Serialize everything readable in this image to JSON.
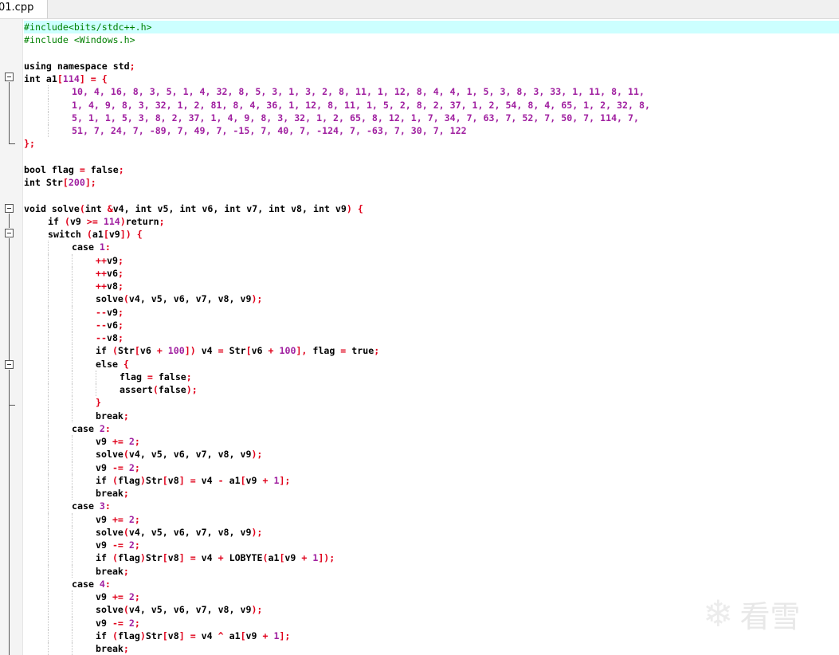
{
  "editor": {
    "tab_label": "01.cpp",
    "watermark_text": "看雪",
    "lines": [
      {
        "indent": 0,
        "hl": true,
        "tokens": [
          [
            "pp",
            "#include<bits/stdc++.h>"
          ]
        ]
      },
      {
        "indent": 0,
        "tokens": [
          [
            "pp",
            "#include <Windows.h>"
          ]
        ]
      },
      {
        "indent": 0,
        "tokens": []
      },
      {
        "indent": 0,
        "tokens": [
          [
            "kw",
            "using namespace "
          ],
          [
            "plain",
            "std"
          ],
          [
            "op",
            ";"
          ]
        ]
      },
      {
        "indent": 0,
        "tokens": [
          [
            "kw",
            "int "
          ],
          [
            "plain",
            "a1"
          ],
          [
            "op",
            "["
          ],
          [
            "num",
            "114"
          ],
          [
            "op",
            "] = {"
          ]
        ]
      },
      {
        "indent": 2,
        "tokens": [
          [
            "num",
            "10, 4, 16, 8, 3, 5, 1, 4, 32, 8, 5, 3, 1, 3, 2, 8, 11, 1, 12, 8, 4, 4, 1, 5, 3, 8, 3, 33, 1, 11, 8, 11,"
          ]
        ]
      },
      {
        "indent": 2,
        "tokens": [
          [
            "num",
            "1, 4, 9, 8, 3, 32, 1, 2, 81, 8, 4, 36, 1, 12, 8, 11, 1, 5, 2, 8, 2, 37, 1, 2, 54, 8, 4, 65, 1, 2, 32, 8,"
          ]
        ]
      },
      {
        "indent": 2,
        "tokens": [
          [
            "num",
            "5, 1, 1, 5, 3, 8, 2, 37, 1, 4, 9, 8, 3, 32, 1, 2, 65, 8, 12, 1, 7, 34, 7, 63, 7, 52, 7, 50, 7, 114, 7,"
          ]
        ]
      },
      {
        "indent": 2,
        "tokens": [
          [
            "num",
            "51, 7, 24, 7, -89, 7, 49, 7, -15, 7, 40, 7, -124, 7, -63, 7, 30, 7, 122"
          ]
        ]
      },
      {
        "indent": 0,
        "tokens": [
          [
            "op",
            "};"
          ]
        ]
      },
      {
        "indent": 0,
        "tokens": []
      },
      {
        "indent": 0,
        "tokens": [
          [
            "kw",
            "bool "
          ],
          [
            "plain",
            "flag "
          ],
          [
            "op",
            "= "
          ],
          [
            "kw",
            "false"
          ],
          [
            "op",
            ";"
          ]
        ]
      },
      {
        "indent": 0,
        "tokens": [
          [
            "kw",
            "int "
          ],
          [
            "plain",
            "Str"
          ],
          [
            "op",
            "["
          ],
          [
            "num",
            "200"
          ],
          [
            "op",
            "];"
          ]
        ]
      },
      {
        "indent": 0,
        "tokens": []
      },
      {
        "indent": 0,
        "tokens": [
          [
            "kw",
            "void "
          ],
          [
            "plain",
            "solve"
          ],
          [
            "op",
            "("
          ],
          [
            "kw",
            "int "
          ],
          [
            "op",
            "&"
          ],
          [
            "plain",
            "v4, "
          ],
          [
            "kw",
            "int "
          ],
          [
            "plain",
            "v5, "
          ],
          [
            "kw",
            "int "
          ],
          [
            "plain",
            "v6, "
          ],
          [
            "kw",
            "int "
          ],
          [
            "plain",
            "v7, "
          ],
          [
            "kw",
            "int "
          ],
          [
            "plain",
            "v8, "
          ],
          [
            "kw",
            "int "
          ],
          [
            "plain",
            "v9"
          ],
          [
            "op",
            ") {"
          ]
        ]
      },
      {
        "indent": 1,
        "tokens": [
          [
            "kw",
            "if "
          ],
          [
            "op",
            "("
          ],
          [
            "plain",
            "v9 "
          ],
          [
            "op",
            ">= "
          ],
          [
            "num",
            "114"
          ],
          [
            "op",
            ")"
          ],
          [
            "kw",
            "return"
          ],
          [
            "op",
            ";"
          ]
        ]
      },
      {
        "indent": 1,
        "tokens": [
          [
            "kw",
            "switch "
          ],
          [
            "op",
            "("
          ],
          [
            "plain",
            "a1"
          ],
          [
            "op",
            "["
          ],
          [
            "plain",
            "v9"
          ],
          [
            "op",
            "]) {"
          ]
        ]
      },
      {
        "indent": 2,
        "tokens": [
          [
            "kw",
            "case "
          ],
          [
            "num",
            "1"
          ],
          [
            "op",
            ":"
          ]
        ]
      },
      {
        "indent": 3,
        "tokens": [
          [
            "op",
            "++"
          ],
          [
            "plain",
            "v9"
          ],
          [
            "op",
            ";"
          ]
        ]
      },
      {
        "indent": 3,
        "tokens": [
          [
            "op",
            "++"
          ],
          [
            "plain",
            "v6"
          ],
          [
            "op",
            ";"
          ]
        ]
      },
      {
        "indent": 3,
        "tokens": [
          [
            "op",
            "++"
          ],
          [
            "plain",
            "v8"
          ],
          [
            "op",
            ";"
          ]
        ]
      },
      {
        "indent": 3,
        "tokens": [
          [
            "plain",
            "solve"
          ],
          [
            "op",
            "("
          ],
          [
            "plain",
            "v4, v5, v6, v7, v8, v9"
          ],
          [
            "op",
            ");"
          ]
        ]
      },
      {
        "indent": 3,
        "tokens": [
          [
            "op",
            "--"
          ],
          [
            "plain",
            "v9"
          ],
          [
            "op",
            ";"
          ]
        ]
      },
      {
        "indent": 3,
        "tokens": [
          [
            "op",
            "--"
          ],
          [
            "plain",
            "v6"
          ],
          [
            "op",
            ";"
          ]
        ]
      },
      {
        "indent": 3,
        "tokens": [
          [
            "op",
            "--"
          ],
          [
            "plain",
            "v8"
          ],
          [
            "op",
            ";"
          ]
        ]
      },
      {
        "indent": 3,
        "tokens": [
          [
            "kw",
            "if "
          ],
          [
            "op",
            "("
          ],
          [
            "plain",
            "Str"
          ],
          [
            "op",
            "["
          ],
          [
            "plain",
            "v6 "
          ],
          [
            "op",
            "+ "
          ],
          [
            "num",
            "100"
          ],
          [
            "op",
            "]) "
          ],
          [
            "plain",
            "v4 "
          ],
          [
            "op",
            "= "
          ],
          [
            "plain",
            "Str"
          ],
          [
            "op",
            "["
          ],
          [
            "plain",
            "v6 "
          ],
          [
            "op",
            "+ "
          ],
          [
            "num",
            "100"
          ],
          [
            "op",
            "], "
          ],
          [
            "plain",
            "flag "
          ],
          [
            "op",
            "= "
          ],
          [
            "kw",
            "true"
          ],
          [
            "op",
            ";"
          ]
        ]
      },
      {
        "indent": 3,
        "tokens": [
          [
            "kw",
            "else "
          ],
          [
            "op",
            "{"
          ]
        ]
      },
      {
        "indent": 4,
        "tokens": [
          [
            "plain",
            "flag "
          ],
          [
            "op",
            "= "
          ],
          [
            "kw",
            "false"
          ],
          [
            "op",
            ";"
          ]
        ]
      },
      {
        "indent": 4,
        "tokens": [
          [
            "plain",
            "assert"
          ],
          [
            "op",
            "("
          ],
          [
            "kw",
            "false"
          ],
          [
            "op",
            ");"
          ]
        ]
      },
      {
        "indent": 3,
        "tokens": [
          [
            "op",
            "}"
          ]
        ]
      },
      {
        "indent": 3,
        "tokens": [
          [
            "kw",
            "break"
          ],
          [
            "op",
            ";"
          ]
        ]
      },
      {
        "indent": 2,
        "tokens": [
          [
            "kw",
            "case "
          ],
          [
            "num",
            "2"
          ],
          [
            "op",
            ":"
          ]
        ]
      },
      {
        "indent": 3,
        "tokens": [
          [
            "plain",
            "v9 "
          ],
          [
            "op",
            "+= "
          ],
          [
            "num",
            "2"
          ],
          [
            "op",
            ";"
          ]
        ]
      },
      {
        "indent": 3,
        "tokens": [
          [
            "plain",
            "solve"
          ],
          [
            "op",
            "("
          ],
          [
            "plain",
            "v4, v5, v6, v7, v8, v9"
          ],
          [
            "op",
            ");"
          ]
        ]
      },
      {
        "indent": 3,
        "tokens": [
          [
            "plain",
            "v9 "
          ],
          [
            "op",
            "-= "
          ],
          [
            "num",
            "2"
          ],
          [
            "op",
            ";"
          ]
        ]
      },
      {
        "indent": 3,
        "tokens": [
          [
            "kw",
            "if "
          ],
          [
            "op",
            "("
          ],
          [
            "plain",
            "flag"
          ],
          [
            "op",
            ")"
          ],
          [
            "plain",
            "Str"
          ],
          [
            "op",
            "["
          ],
          [
            "plain",
            "v8"
          ],
          [
            "op",
            "] = "
          ],
          [
            "plain",
            "v4 "
          ],
          [
            "op",
            "- "
          ],
          [
            "plain",
            "a1"
          ],
          [
            "op",
            "["
          ],
          [
            "plain",
            "v9 "
          ],
          [
            "op",
            "+ "
          ],
          [
            "num",
            "1"
          ],
          [
            "op",
            "];"
          ]
        ]
      },
      {
        "indent": 3,
        "tokens": [
          [
            "kw",
            "break"
          ],
          [
            "op",
            ";"
          ]
        ]
      },
      {
        "indent": 2,
        "tokens": [
          [
            "kw",
            "case "
          ],
          [
            "num",
            "3"
          ],
          [
            "op",
            ":"
          ]
        ]
      },
      {
        "indent": 3,
        "tokens": [
          [
            "plain",
            "v9 "
          ],
          [
            "op",
            "+= "
          ],
          [
            "num",
            "2"
          ],
          [
            "op",
            ";"
          ]
        ]
      },
      {
        "indent": 3,
        "tokens": [
          [
            "plain",
            "solve"
          ],
          [
            "op",
            "("
          ],
          [
            "plain",
            "v4, v5, v6, v7, v8, v9"
          ],
          [
            "op",
            ");"
          ]
        ]
      },
      {
        "indent": 3,
        "tokens": [
          [
            "plain",
            "v9 "
          ],
          [
            "op",
            "-= "
          ],
          [
            "num",
            "2"
          ],
          [
            "op",
            ";"
          ]
        ]
      },
      {
        "indent": 3,
        "tokens": [
          [
            "kw",
            "if "
          ],
          [
            "op",
            "("
          ],
          [
            "plain",
            "flag"
          ],
          [
            "op",
            ")"
          ],
          [
            "plain",
            "Str"
          ],
          [
            "op",
            "["
          ],
          [
            "plain",
            "v8"
          ],
          [
            "op",
            "] = "
          ],
          [
            "plain",
            "v4 "
          ],
          [
            "op",
            "+ "
          ],
          [
            "plain",
            "LOBYTE"
          ],
          [
            "op",
            "("
          ],
          [
            "plain",
            "a1"
          ],
          [
            "op",
            "["
          ],
          [
            "plain",
            "v9 "
          ],
          [
            "op",
            "+ "
          ],
          [
            "num",
            "1"
          ],
          [
            "op",
            "]);"
          ]
        ]
      },
      {
        "indent": 3,
        "tokens": [
          [
            "kw",
            "break"
          ],
          [
            "op",
            ";"
          ]
        ]
      },
      {
        "indent": 2,
        "tokens": [
          [
            "kw",
            "case "
          ],
          [
            "num",
            "4"
          ],
          [
            "op",
            ":"
          ]
        ]
      },
      {
        "indent": 3,
        "tokens": [
          [
            "plain",
            "v9 "
          ],
          [
            "op",
            "+= "
          ],
          [
            "num",
            "2"
          ],
          [
            "op",
            ";"
          ]
        ]
      },
      {
        "indent": 3,
        "tokens": [
          [
            "plain",
            "solve"
          ],
          [
            "op",
            "("
          ],
          [
            "plain",
            "v4, v5, v6, v7, v8, v9"
          ],
          [
            "op",
            ");"
          ]
        ]
      },
      {
        "indent": 3,
        "tokens": [
          [
            "plain",
            "v9 "
          ],
          [
            "op",
            "-= "
          ],
          [
            "num",
            "2"
          ],
          [
            "op",
            ";"
          ]
        ]
      },
      {
        "indent": 3,
        "tokens": [
          [
            "kw",
            "if "
          ],
          [
            "op",
            "("
          ],
          [
            "plain",
            "flag"
          ],
          [
            "op",
            ")"
          ],
          [
            "plain",
            "Str"
          ],
          [
            "op",
            "["
          ],
          [
            "plain",
            "v8"
          ],
          [
            "op",
            "] = "
          ],
          [
            "plain",
            "v4 "
          ],
          [
            "op",
            "^ "
          ],
          [
            "plain",
            "a1"
          ],
          [
            "op",
            "["
          ],
          [
            "plain",
            "v9 "
          ],
          [
            "op",
            "+ "
          ],
          [
            "num",
            "1"
          ],
          [
            "op",
            "];"
          ]
        ]
      },
      {
        "indent": 3,
        "tokens": [
          [
            "kw",
            "break"
          ],
          [
            "op",
            ";"
          ]
        ]
      }
    ]
  }
}
